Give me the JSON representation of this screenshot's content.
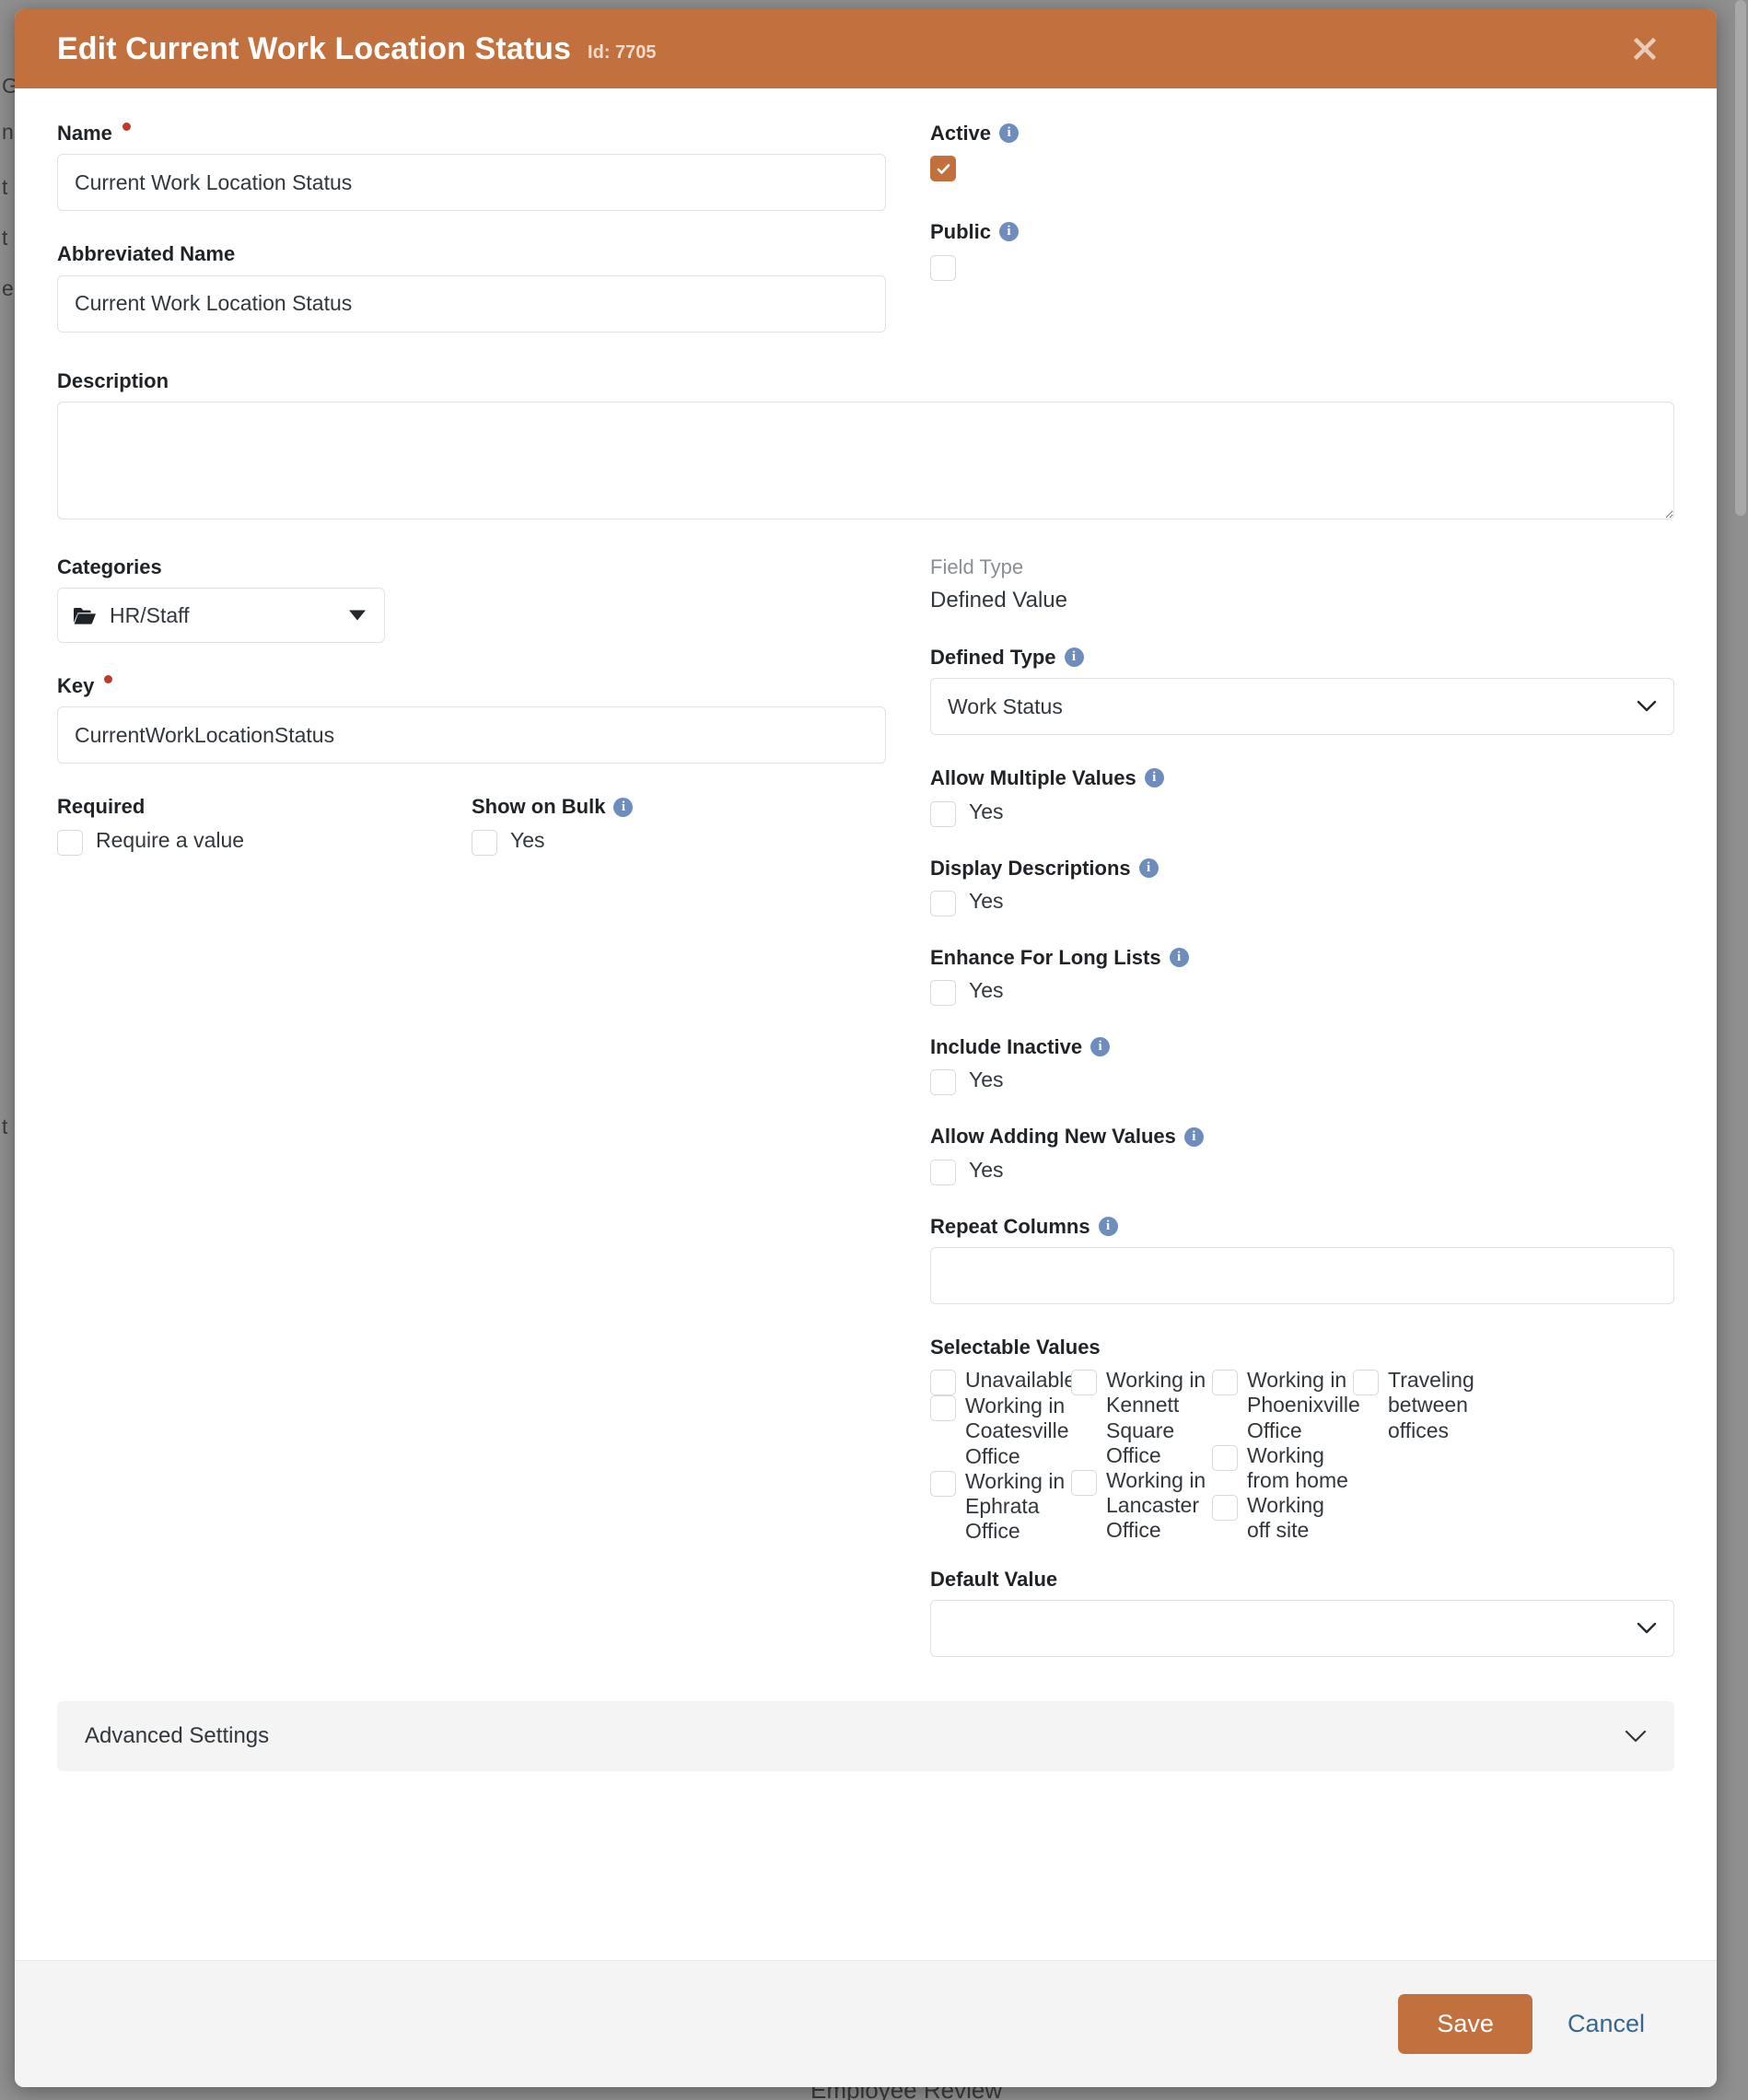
{
  "background": {
    "left_fragments": [
      "G",
      "n",
      "t",
      "t",
      "er",
      "t"
    ],
    "bottom_label": "Employee Review"
  },
  "modal": {
    "title": "Edit Current Work Location Status",
    "id_label": "Id: 7705",
    "close_icon": "close-icon",
    "accent_color": "#c1703e",
    "link_color": "#37678f",
    "info_icon_color": "#6e8dbd",
    "required_dot_color": "#c0392b"
  },
  "left_column": {
    "name": {
      "label": "Name",
      "required": true,
      "value": "Current Work Location Status",
      "placeholder": ""
    },
    "abbreviated_name": {
      "label": "Abbreviated Name",
      "value": "Current Work Location Status",
      "placeholder": ""
    },
    "description": {
      "label": "Description",
      "value": "",
      "placeholder": ""
    },
    "categories": {
      "label": "Categories",
      "value": "HR/Staff",
      "icon": "folder-open-icon"
    },
    "key": {
      "label": "Key",
      "required": true,
      "value": "CurrentWorkLocationStatus",
      "placeholder": ""
    },
    "required_field": {
      "label": "Required",
      "checkbox_label": "Require a value",
      "checked": false
    },
    "show_on_bulk": {
      "label": "Show on Bulk",
      "checkbox_label": "Yes",
      "checked": false,
      "has_info": true
    }
  },
  "right_column": {
    "active": {
      "label": "Active",
      "checked": true,
      "has_info": true
    },
    "public": {
      "label": "Public",
      "checked": false,
      "has_info": true
    },
    "field_type": {
      "label": "Field Type",
      "value": "Defined Value"
    },
    "defined_type": {
      "label": "Defined Type",
      "value": "Work Status",
      "has_info": true
    },
    "toggles": [
      {
        "label": "Allow Multiple Values",
        "checkbox_label": "Yes",
        "checked": false,
        "has_info": true
      },
      {
        "label": "Display Descriptions",
        "checkbox_label": "Yes",
        "checked": false,
        "has_info": true
      },
      {
        "label": "Enhance For Long Lists",
        "checkbox_label": "Yes",
        "checked": false,
        "has_info": true
      },
      {
        "label": "Include Inactive",
        "checkbox_label": "Yes",
        "checked": false,
        "has_info": true
      },
      {
        "label": "Allow Adding New Values",
        "checkbox_label": "Yes",
        "checked": false,
        "has_info": true
      }
    ],
    "repeat_columns": {
      "label": "Repeat Columns",
      "value": "",
      "placeholder": "",
      "has_info": true
    },
    "selectable_values": {
      "label": "Selectable Values",
      "columns": [
        [
          {
            "label": "Unavailable",
            "checked": false
          },
          {
            "label": "Working in Coatesville Office",
            "checked": false
          },
          {
            "label": "Working in Ephrata Office",
            "checked": false
          }
        ],
        [
          {
            "label": "Working in Kennett Square Office",
            "checked": false
          },
          {
            "label": "Working in Lancaster Office",
            "checked": false
          }
        ],
        [
          {
            "label": "Working in Phoenixville Office",
            "checked": false
          },
          {
            "label": "Working from home",
            "checked": false
          },
          {
            "label": "Working off site",
            "checked": false
          }
        ],
        [
          {
            "label": "Traveling between offices",
            "checked": false
          }
        ]
      ]
    },
    "default_value": {
      "label": "Default Value",
      "value": "",
      "placeholder": ""
    }
  },
  "advanced_settings": {
    "label": "Advanced Settings",
    "expanded": false,
    "chevron_icon": "chevron-down-icon"
  },
  "footer": {
    "save_label": "Save",
    "cancel_label": "Cancel"
  }
}
